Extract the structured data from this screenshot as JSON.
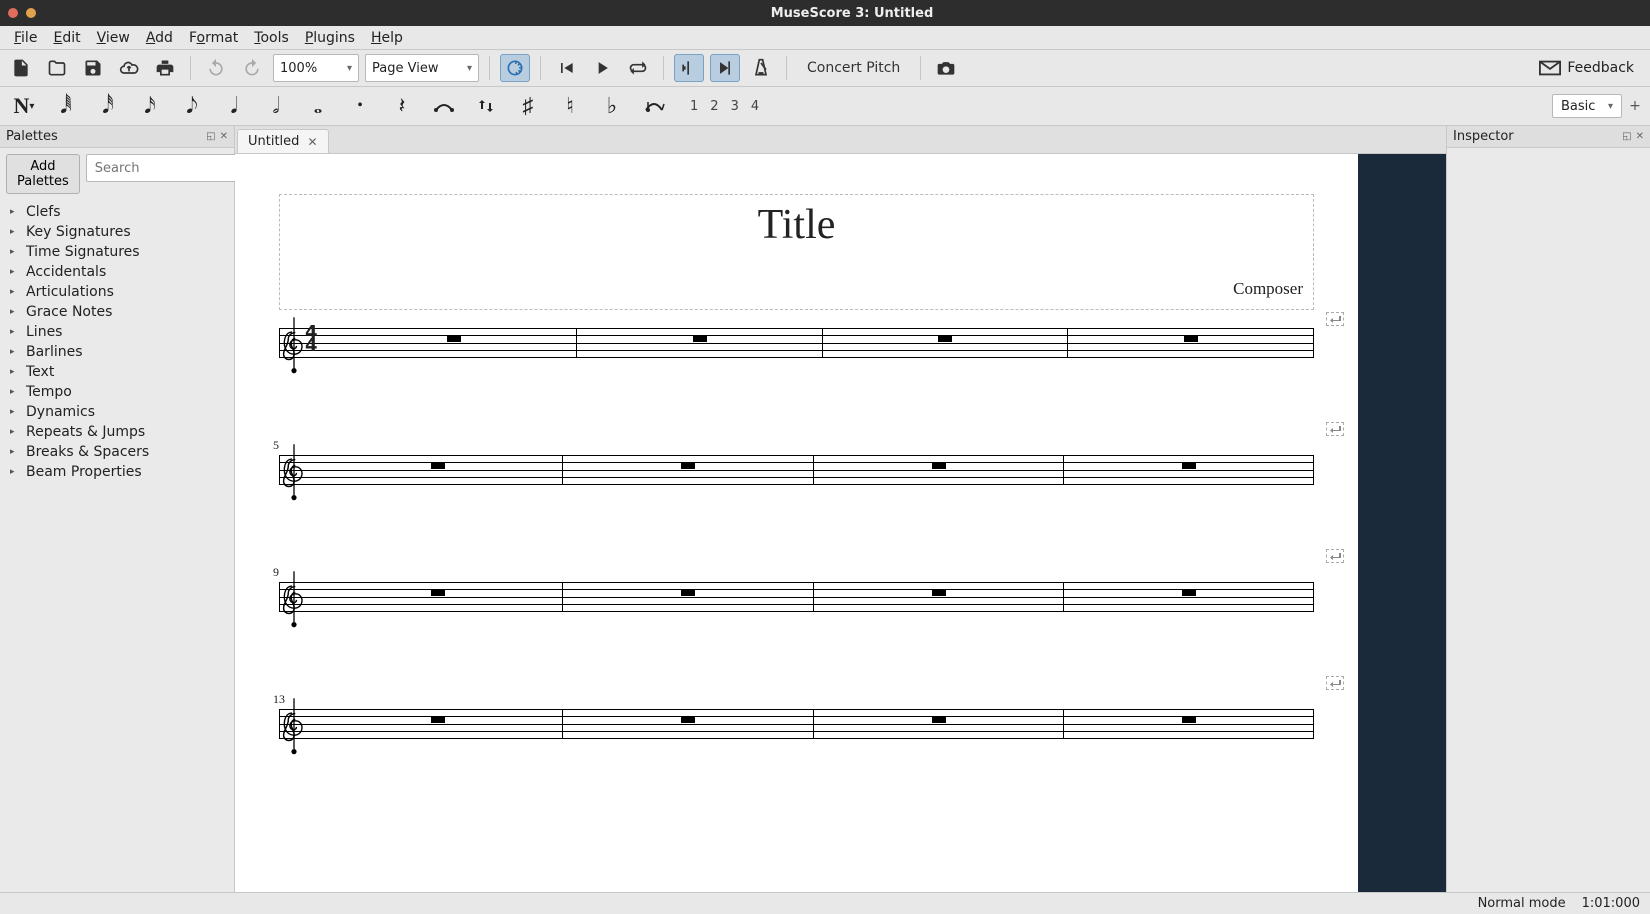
{
  "window": {
    "title": "MuseScore 3: Untitled"
  },
  "menubar": [
    "File",
    "Edit",
    "View",
    "Add",
    "Format",
    "Tools",
    "Plugins",
    "Help"
  ],
  "toolbar1": {
    "zoom": "100%",
    "view_mode": "Page View",
    "concert_pitch_label": "Concert Pitch",
    "feedback_label": "Feedback"
  },
  "toolbar2": {
    "voices": [
      "1",
      "2",
      "3",
      "4"
    ],
    "workspace": "Basic"
  },
  "palettes": {
    "header": "Palettes",
    "add_button": "Add Palettes",
    "search_placeholder": "Search",
    "items": [
      "Clefs",
      "Key Signatures",
      "Time Signatures",
      "Accidentals",
      "Articulations",
      "Grace Notes",
      "Lines",
      "Barlines",
      "Text",
      "Tempo",
      "Dynamics",
      "Repeats & Jumps",
      "Breaks & Spacers",
      "Beam Properties"
    ]
  },
  "tabs": {
    "active": "Untitled"
  },
  "score": {
    "title": "Title",
    "composer": "Composer",
    "time_signature": {
      "top": "4",
      "bottom": "4"
    },
    "systems": [
      {
        "measure_number_label": "",
        "show_timesig": true
      },
      {
        "measure_number_label": "5",
        "show_timesig": false
      },
      {
        "measure_number_label": "9",
        "show_timesig": false
      },
      {
        "measure_number_label": "13",
        "show_timesig": false
      }
    ]
  },
  "inspector": {
    "header": "Inspector"
  },
  "statusbar": {
    "mode": "Normal mode",
    "position": "1:01:000"
  }
}
